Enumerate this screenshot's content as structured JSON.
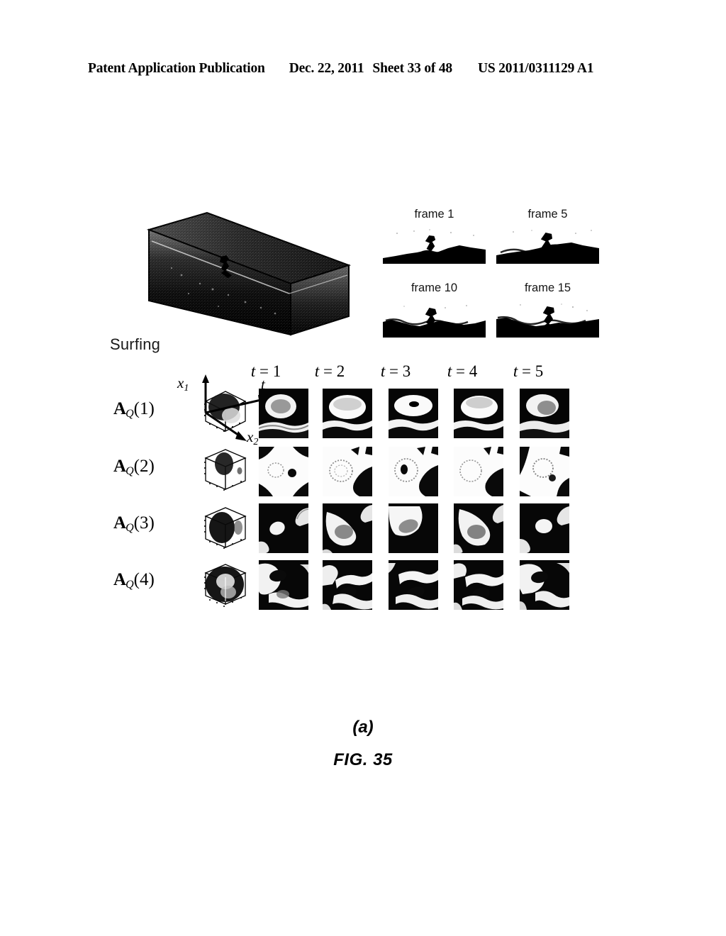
{
  "header": {
    "publication": "Patent Application Publication",
    "date": "Dec. 22, 2011",
    "sheet": "Sheet 33 of 48",
    "patent_number": "US 2011/0311129 A1"
  },
  "figure": {
    "volume_label": "Surfing",
    "frames": [
      {
        "caption": "frame 1"
      },
      {
        "caption": "frame 5"
      },
      {
        "caption": "frame 10"
      },
      {
        "caption": "frame 15"
      }
    ],
    "axes": {
      "vertical": "x",
      "vertical_sub": "1",
      "depth": "x",
      "depth_sub": "2",
      "time": "t"
    },
    "column_headers": [
      {
        "var": "t",
        "eq": " = ",
        "num": "1"
      },
      {
        "var": "t",
        "eq": " = ",
        "num": "2"
      },
      {
        "var": "t",
        "eq": " = ",
        "num": "3"
      },
      {
        "var": "t",
        "eq": " = ",
        "num": "4"
      },
      {
        "var": "t",
        "eq": " = ",
        "num": "5"
      }
    ],
    "row_labels": [
      {
        "sym": "A",
        "sub": "Q",
        "index": "(1)"
      },
      {
        "sym": "A",
        "sub": "Q",
        "index": "(2)"
      },
      {
        "sym": "A",
        "sub": "Q",
        "index": "(3)"
      },
      {
        "sym": "A",
        "sub": "Q",
        "index": "(4)"
      }
    ],
    "caption_a": "(a)",
    "caption_fig": "FIG. 35"
  },
  "colors": {
    "ink": "#000000",
    "paper": "#ffffff",
    "mid_gray": "#8a8a8a"
  }
}
